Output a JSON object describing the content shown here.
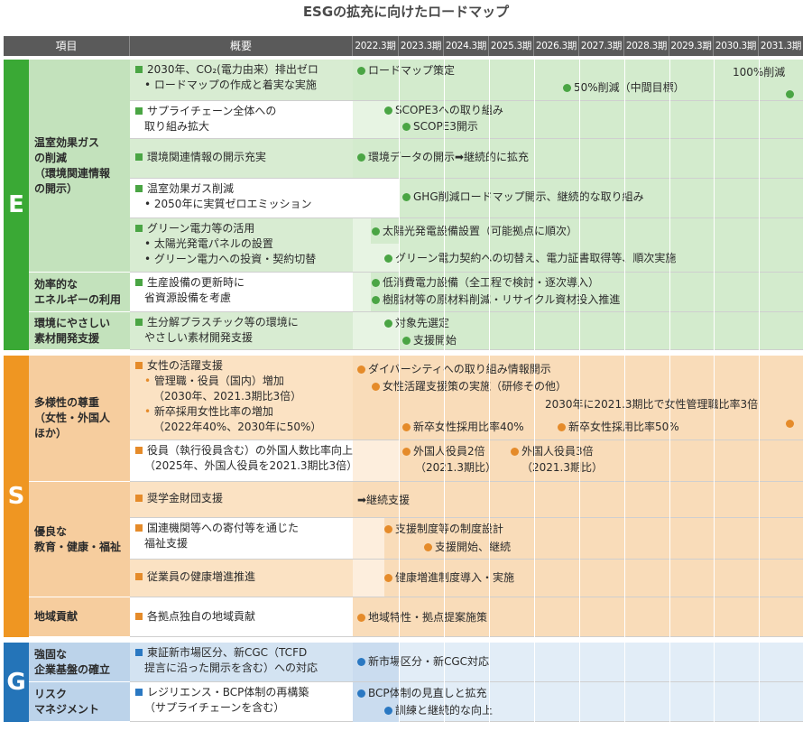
{
  "title": "ESGの拡充に向けたロードマップ",
  "header": {
    "item": "項目",
    "overview": "概要",
    "years": [
      "2022.3期",
      "2023.3期",
      "2024.3期",
      "2025.3期",
      "2026.3期",
      "2027.3期",
      "2028.3期",
      "2029.3期",
      "2030.3期",
      "2031.3期"
    ]
  },
  "colors": {
    "e_accent": "#3aa935",
    "e_item_bg": "#c3e2bc",
    "e_light": "#e7f4e3",
    "e_fill": "#d3ebcd",
    "s_accent": "#ef9622",
    "s_item_bg": "#f6cd9e",
    "s_light": "#fdeedd",
    "s_fill": "#f9dcb9",
    "g_accent": "#2474b8",
    "g_item_bg": "#bcd3ea",
    "g_light": "#e2edf7",
    "g_fill": "#cadcef"
  },
  "sections": {
    "E": {
      "letter": "E",
      "items": [
        "温室効果ガス\nの削減\n（環境関連情報\nの開示）",
        "効率的な\nエネルギーの利用",
        "環境にやさしい\n素材開発支援"
      ],
      "rows": [
        {
          "desc": [
            "2030年、CO₂(電力由来）排出ゼロ",
            "ロードマップの作成と着実な実施"
          ],
          "events": [
            "ロードマップ策定",
            "50%削減（中間目標）",
            "100%削減"
          ]
        },
        {
          "desc": [
            "サプライチェーン全体への",
            "取り組み拡大"
          ],
          "events": [
            "SCOPE3への取り組み",
            "SCOPE3開示"
          ]
        },
        {
          "desc": [
            "環境関連情報の開示充実"
          ],
          "events": [
            "環境データの開示➡継続的に拡充"
          ]
        },
        {
          "desc": [
            "温室効果ガス削減",
            "2050年に実質ゼロエミッション"
          ],
          "events": [
            "GHG削減ロードマップ開示、継続的な取り組み"
          ]
        },
        {
          "desc": [
            "グリーン電力等の活用",
            "太陽光発電パネルの設置",
            "グリーン電力への投資・契約切替"
          ],
          "events": [
            "太陽光発電設備設置（可能拠点に順次）",
            "グリーン電力契約への切替え、電力証書取得等、順次実施"
          ]
        },
        {
          "desc": [
            "生産設備の更新時に",
            "省資源設備を考慮"
          ],
          "events": [
            "低消費電力設備（全工程で検討・逐次導入）",
            "樹脂材等の原材料削減・リサイクル資材投入推進"
          ]
        },
        {
          "desc": [
            "生分解プラスチック等の環境に",
            "やさしい素材開発支援"
          ],
          "events": [
            "対象先選定",
            "支援開始"
          ]
        }
      ]
    },
    "S": {
      "letter": "S",
      "items": [
        "多様性の尊重\n（女性・外国人\nほか）",
        "優良な\n教育・健康・福祉",
        "地域貢献"
      ],
      "rows": [
        {
          "desc": [
            "女性の活躍支援",
            "管理職・役員（国内）増加",
            "（2030年、2021.3期比3倍）",
            "新卒採用女性比率の増加",
            "（2022年40%、2030年に50%）"
          ],
          "events": [
            "ダイバーシティへの取り組み情報開示",
            "女性活躍支援策の実施（研修その他）",
            "2030年に2021.3期比で女性管理職比率3倍",
            "新卒女性採用比率40%",
            "新卒女性採用比率50%"
          ]
        },
        {
          "desc": [
            "役員（執行役員含む）の外国人数比率向上",
            "（2025年、外国人役員を2021.3期比3倍）"
          ],
          "events": [
            "外国人役員2倍",
            "（2021.3期比）",
            "外国人役員3倍",
            "（2021.3期比）"
          ]
        },
        {
          "desc": [
            "奨学金財団支援"
          ],
          "events": [
            "➡継続支援"
          ]
        },
        {
          "desc": [
            "国連機関等への寄付等を通じた",
            "福祉支援"
          ],
          "events": [
            "支援制度等の制度設計",
            "支援開始、継続"
          ]
        },
        {
          "desc": [
            "従業員の健康増進推進"
          ],
          "events": [
            "健康増進制度導入・実施"
          ]
        },
        {
          "desc": [
            "各拠点独自の地域貢献"
          ],
          "events": [
            "地域特性・拠点提案施策"
          ]
        }
      ]
    },
    "G": {
      "letter": "G",
      "items": [
        "強固な\n企業基盤の確立",
        "リスク\nマネジメント"
      ],
      "rows": [
        {
          "desc": [
            "東証新市場区分、新CGC（TCFD",
            "提言に沿った開示を含む）への対応"
          ],
          "events": [
            "新市場区分・新CGC対応"
          ]
        },
        {
          "desc": [
            "レジリエンス・BCP体制の再構築",
            "（サプライチェーンを含む）"
          ],
          "events": [
            "BCP体制の見直しと拡充",
            "訓練と継続的な向上"
          ]
        }
      ]
    }
  }
}
